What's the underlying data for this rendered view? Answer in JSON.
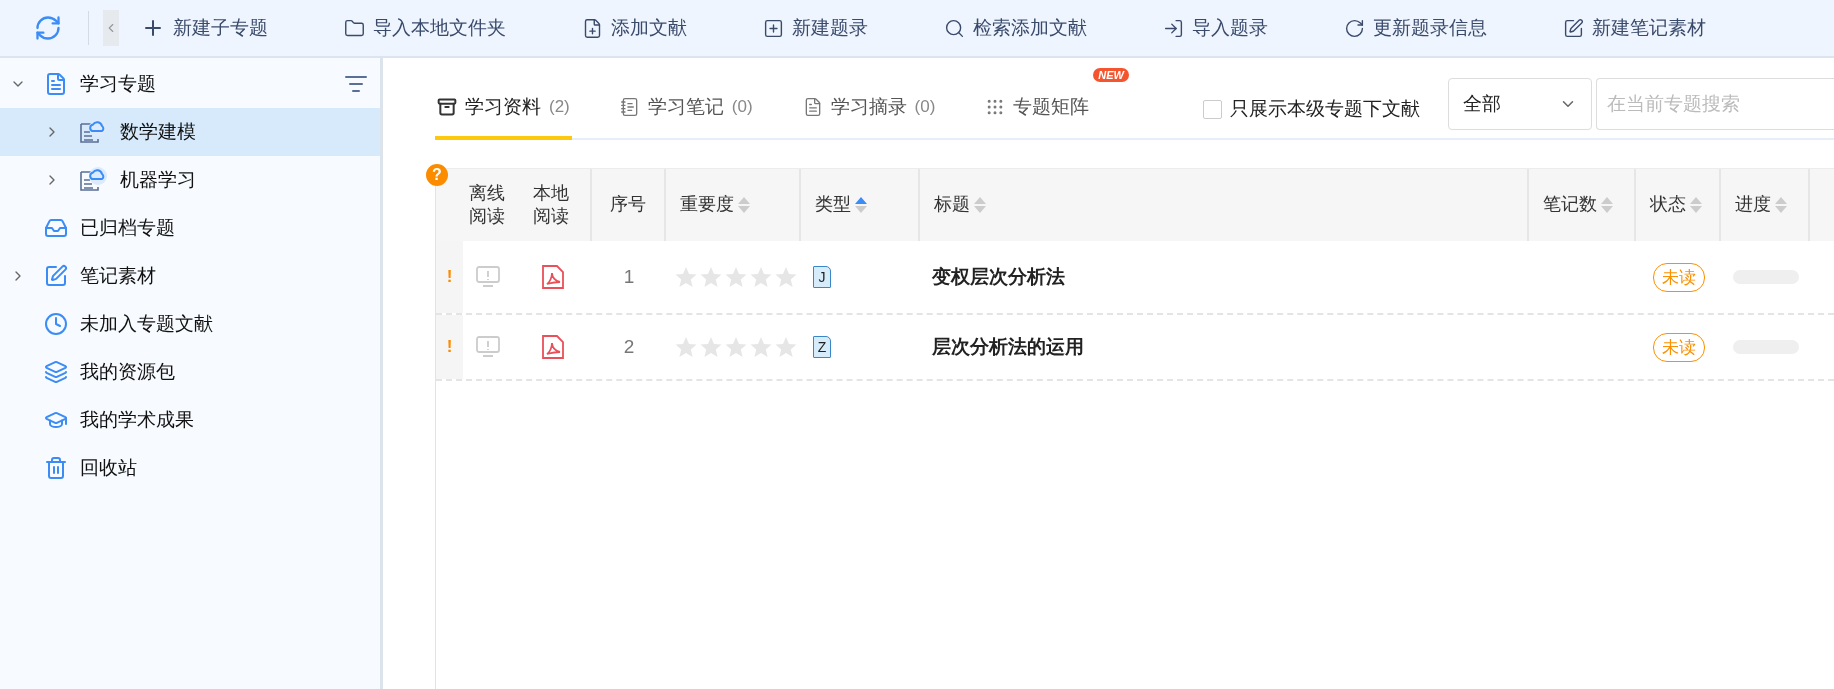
{
  "toolbar": {
    "items": [
      {
        "label": "新建子专题"
      },
      {
        "label": "导入本地文件夹"
      },
      {
        "label": "添加文献"
      },
      {
        "label": "新建题录"
      },
      {
        "label": "检索添加文献"
      },
      {
        "label": "导入题录"
      },
      {
        "label": "更新题录信息"
      },
      {
        "label": "新建笔记素材"
      }
    ]
  },
  "sidebar": {
    "items": [
      {
        "label": "学习专题",
        "expandable": true,
        "expanded": true,
        "selected": false,
        "children": [
          {
            "label": "数学建模",
            "expandable": true,
            "expanded": false,
            "selected": true
          },
          {
            "label": "机器学习",
            "expandable": true,
            "expanded": false,
            "selected": false
          }
        ]
      },
      {
        "label": "已归档专题",
        "expandable": false,
        "selected": false
      },
      {
        "label": "笔记素材",
        "expandable": true,
        "expanded": false,
        "selected": false
      },
      {
        "label": "未加入专题文献",
        "expandable": false,
        "selected": false
      },
      {
        "label": "我的资源包",
        "expandable": false,
        "selected": false
      },
      {
        "label": "我的学术成果",
        "expandable": false,
        "selected": false
      },
      {
        "label": "回收站",
        "expandable": false,
        "selected": false
      }
    ]
  },
  "tabs": [
    {
      "label": "学习资料",
      "count": "(2)",
      "selected": true
    },
    {
      "label": "学习笔记",
      "count": "(0)",
      "selected": false
    },
    {
      "label": "学习摘录",
      "count": "(0)",
      "selected": false
    },
    {
      "label": "专题矩阵",
      "badge": "NEW",
      "selected": false
    }
  ],
  "filter": {
    "label": "只展示本级专题下文献",
    "checked": false
  },
  "scope_select": {
    "value": "全部"
  },
  "search": {
    "placeholder": "在当前专题搜索"
  },
  "table": {
    "help_mark": "?",
    "columns": [
      {
        "label": "离线阅读",
        "sortable": false
      },
      {
        "label": "本地阅读",
        "sortable": false
      },
      {
        "label": "序号",
        "sortable": false
      },
      {
        "label": "重要度",
        "sortable": true,
        "sorted_ascending": false
      },
      {
        "label": "类型",
        "sortable": true,
        "sorted_ascending": true
      },
      {
        "label": "标题",
        "sortable": true,
        "sorted_ascending": false
      },
      {
        "label": "笔记数",
        "sortable": true,
        "sorted_ascending": false
      },
      {
        "label": "状态",
        "sortable": true,
        "sorted_ascending": false
      },
      {
        "label": "进度",
        "sortable": true,
        "sorted_ascending": false
      }
    ],
    "rows": [
      {
        "flag": "!",
        "index": "1",
        "stars": 0,
        "type": "J",
        "title": "变权层次分析法",
        "status": "未读",
        "level": 0
      },
      {
        "flag": "!",
        "index": "2",
        "stars": 0,
        "type": "Z",
        "title": "层次分析法的运用",
        "status": "未读",
        "level": 0
      }
    ]
  }
}
